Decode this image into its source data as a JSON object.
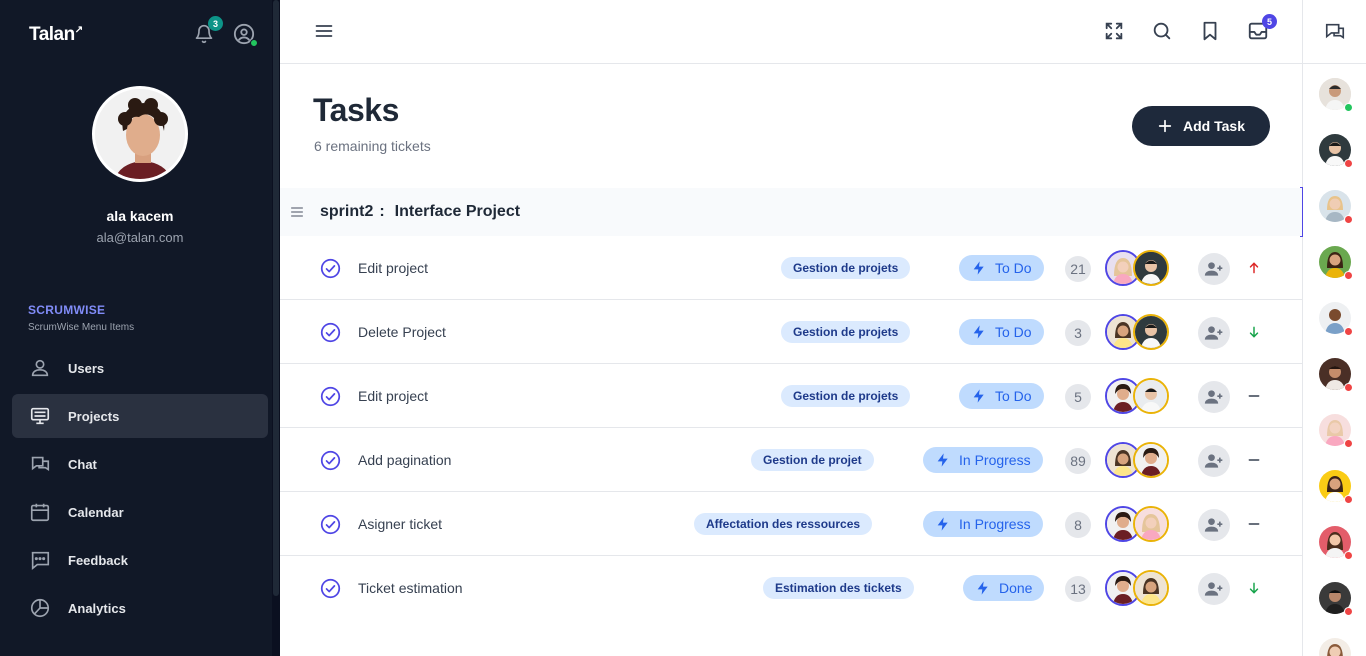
{
  "app": {
    "logo": "Talan",
    "notifications_count": "3"
  },
  "user": {
    "name": "ala kacem",
    "email": "ala@talan.com"
  },
  "menu": {
    "section_title": "SCRUMWISE",
    "section_subtitle": "ScrumWise Menu Items",
    "items": [
      {
        "label": "Users",
        "icon": "users-icon",
        "active": false
      },
      {
        "label": "Projects",
        "icon": "monitor-icon",
        "active": true
      },
      {
        "label": "Chat",
        "icon": "chat-icon",
        "active": false
      },
      {
        "label": "Calendar",
        "icon": "calendar-icon",
        "active": false
      },
      {
        "label": "Feedback",
        "icon": "feedback-icon",
        "active": false
      },
      {
        "label": "Analytics",
        "icon": "pie-chart-icon",
        "active": false
      }
    ]
  },
  "header": {
    "inbox_count": "5"
  },
  "page": {
    "title": "Tasks",
    "subtitle": "6 remaining tickets",
    "add_button": "Add Task"
  },
  "sprint": {
    "name": "sprint2",
    "separator": ":",
    "project": "Interface Project"
  },
  "tasks": [
    {
      "name": "Edit project",
      "category": "Gestion de projets",
      "status": "To Do",
      "points": "21",
      "priority": "high"
    },
    {
      "name": "Delete Project",
      "category": "Gestion de projets",
      "status": "To Do",
      "points": "3",
      "priority": "low"
    },
    {
      "name": "Edit project",
      "category": "Gestion de projets",
      "status": "To Do",
      "points": "5",
      "priority": "medium"
    },
    {
      "name": "Add pagination",
      "category": "Gestion de projet",
      "status": "In Progress",
      "points": "89",
      "priority": "medium"
    },
    {
      "name": "Asigner ticket",
      "category": "Affectation des ressources",
      "status": "In Progress",
      "points": "8",
      "priority": "medium"
    },
    {
      "name": "Ticket estimation",
      "category": "Estimation des tickets",
      "status": "Done",
      "points": "13",
      "priority": "low"
    }
  ],
  "colors": {
    "sidebar_bg": "#111827",
    "accent": "#4f46e5",
    "status_bg": "#bfdbfe",
    "status_text": "#2563eb",
    "priority_high": "#dc2626",
    "priority_low": "#16a34a",
    "priority_medium": "#374151",
    "online": "#22c55e",
    "busy": "#ef4444"
  }
}
